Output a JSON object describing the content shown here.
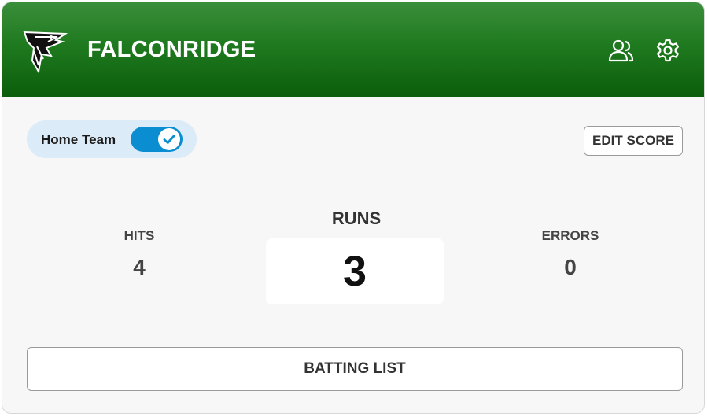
{
  "header": {
    "team_name": "FALCONRIDGE",
    "logo_icon": "falcon-logo-icon",
    "users_icon": "users-icon",
    "settings_icon": "gear-icon"
  },
  "toggle": {
    "label": "Home Team",
    "checked": true
  },
  "edit_score_label": "EDIT SCORE",
  "stats": {
    "hits_label": "HITS",
    "hits_value": "4",
    "runs_label": "RUNS",
    "runs_value": "3",
    "errors_label": "ERRORS",
    "errors_value": "0"
  },
  "batting_list_label": "BATTING LIST",
  "colors": {
    "header_green": "#0b5e0b",
    "toggle_blue": "#0b8ed1",
    "toggle_bg": "#dcebf8"
  }
}
